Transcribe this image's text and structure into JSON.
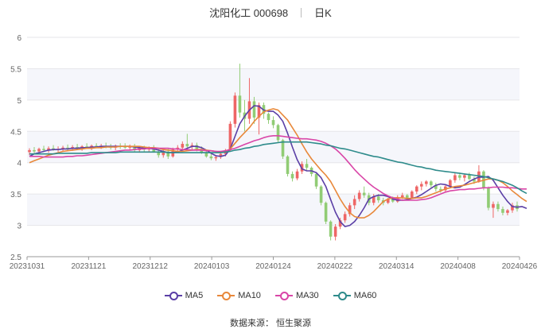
{
  "header": {
    "stock": "沈阳化工 000698",
    "period": "日K"
  },
  "source": "数据来源：  恒生聚源",
  "chart_data": {
    "type": "candlestick",
    "xlabels": [
      "20231031",
      "20231121",
      "20231212",
      "20240103",
      "20240124",
      "20240222",
      "20240314",
      "20240408",
      "20240426"
    ],
    "ylim": [
      2.5,
      6
    ],
    "yticks": [
      "2.5",
      "3",
      "3.5",
      "4",
      "4.5",
      "5",
      "5.5",
      "6"
    ],
    "grid": true,
    "legend_position": "bottom",
    "up_color": "#ee6666",
    "down_color": "#91cc75",
    "candles": [
      {
        "o": 4.17,
        "h": 4.23,
        "l": 4.12,
        "c": 4.2
      },
      {
        "o": 4.2,
        "h": 4.25,
        "l": 4.15,
        "c": 4.18
      },
      {
        "o": 4.18,
        "h": 4.24,
        "l": 4.14,
        "c": 4.22
      },
      {
        "o": 4.22,
        "h": 4.27,
        "l": 4.18,
        "c": 4.2
      },
      {
        "o": 4.2,
        "h": 4.26,
        "l": 4.16,
        "c": 4.23
      },
      {
        "o": 4.23,
        "h": 4.28,
        "l": 4.19,
        "c": 4.21
      },
      {
        "o": 4.21,
        "h": 4.26,
        "l": 4.17,
        "c": 4.22
      },
      {
        "o": 4.22,
        "h": 4.27,
        "l": 4.18,
        "c": 4.24
      },
      {
        "o": 4.24,
        "h": 4.29,
        "l": 4.2,
        "c": 4.22
      },
      {
        "o": 4.22,
        "h": 4.28,
        "l": 4.19,
        "c": 4.25
      },
      {
        "o": 4.25,
        "h": 4.3,
        "l": 4.21,
        "c": 4.23
      },
      {
        "o": 4.23,
        "h": 4.28,
        "l": 4.19,
        "c": 4.26
      },
      {
        "o": 4.26,
        "h": 4.31,
        "l": 4.22,
        "c": 4.24
      },
      {
        "o": 4.24,
        "h": 4.29,
        "l": 4.2,
        "c": 4.27
      },
      {
        "o": 4.27,
        "h": 4.31,
        "l": 4.23,
        "c": 4.25
      },
      {
        "o": 4.25,
        "h": 4.3,
        "l": 4.22,
        "c": 4.27
      },
      {
        "o": 4.27,
        "h": 4.32,
        "l": 4.23,
        "c": 4.26
      },
      {
        "o": 4.26,
        "h": 4.3,
        "l": 4.21,
        "c": 4.24
      },
      {
        "o": 4.24,
        "h": 4.29,
        "l": 4.2,
        "c": 4.27
      },
      {
        "o": 4.27,
        "h": 4.31,
        "l": 4.22,
        "c": 4.26
      },
      {
        "o": 4.26,
        "h": 4.31,
        "l": 4.22,
        "c": 4.24
      },
      {
        "o": 4.24,
        "h": 4.29,
        "l": 4.2,
        "c": 4.26
      },
      {
        "o": 4.26,
        "h": 4.3,
        "l": 4.18,
        "c": 4.2
      },
      {
        "o": 4.2,
        "h": 4.26,
        "l": 4.16,
        "c": 4.23
      },
      {
        "o": 4.23,
        "h": 4.27,
        "l": 4.18,
        "c": 4.21
      },
      {
        "o": 4.21,
        "h": 4.26,
        "l": 4.17,
        "c": 4.24
      },
      {
        "o": 4.24,
        "h": 4.28,
        "l": 4.16,
        "c": 4.18
      },
      {
        "o": 4.18,
        "h": 4.22,
        "l": 4.08,
        "c": 4.12
      },
      {
        "o": 4.12,
        "h": 4.2,
        "l": 4.08,
        "c": 4.18
      },
      {
        "o": 4.18,
        "h": 4.23,
        "l": 4.06,
        "c": 4.1
      },
      {
        "o": 4.1,
        "h": 4.24,
        "l": 4.08,
        "c": 4.21
      },
      {
        "o": 4.21,
        "h": 4.28,
        "l": 4.18,
        "c": 4.24
      },
      {
        "o": 4.24,
        "h": 4.34,
        "l": 4.2,
        "c": 4.3
      },
      {
        "o": 4.3,
        "h": 4.46,
        "l": 4.22,
        "c": 4.26
      },
      {
        "o": 4.26,
        "h": 4.32,
        "l": 4.2,
        "c": 4.28
      },
      {
        "o": 4.28,
        "h": 4.32,
        "l": 4.18,
        "c": 4.22
      },
      {
        "o": 4.22,
        "h": 4.26,
        "l": 4.14,
        "c": 4.16
      },
      {
        "o": 4.16,
        "h": 4.2,
        "l": 4.08,
        "c": 4.1
      },
      {
        "o": 4.1,
        "h": 4.14,
        "l": 4.04,
        "c": 4.07
      },
      {
        "o": 4.07,
        "h": 4.12,
        "l": 4.03,
        "c": 4.09
      },
      {
        "o": 4.09,
        "h": 4.16,
        "l": 4.06,
        "c": 4.14
      },
      {
        "o": 4.14,
        "h": 4.22,
        "l": 4.1,
        "c": 4.2
      },
      {
        "o": 4.2,
        "h": 4.66,
        "l": 4.18,
        "c": 4.62
      },
      {
        "o": 4.62,
        "h": 5.12,
        "l": 4.56,
        "c": 5.07
      },
      {
        "o": 5.07,
        "h": 5.58,
        "l": 4.72,
        "c": 4.8
      },
      {
        "o": 4.8,
        "h": 5.0,
        "l": 4.5,
        "c": 4.7
      },
      {
        "o": 4.7,
        "h": 5.35,
        "l": 4.62,
        "c": 4.98
      },
      {
        "o": 4.98,
        "h": 5.05,
        "l": 4.62,
        "c": 4.72
      },
      {
        "o": 4.72,
        "h": 4.96,
        "l": 4.45,
        "c": 4.92
      },
      {
        "o": 4.92,
        "h": 4.96,
        "l": 4.7,
        "c": 4.78
      },
      {
        "o": 4.78,
        "h": 4.8,
        "l": 4.62,
        "c": 4.68
      },
      {
        "o": 4.68,
        "h": 4.74,
        "l": 4.55,
        "c": 4.6
      },
      {
        "o": 4.6,
        "h": 4.62,
        "l": 4.32,
        "c": 4.36
      },
      {
        "o": 4.36,
        "h": 4.38,
        "l": 4.06,
        "c": 4.1
      },
      {
        "o": 4.1,
        "h": 4.12,
        "l": 3.78,
        "c": 3.82
      },
      {
        "o": 3.82,
        "h": 3.86,
        "l": 3.7,
        "c": 3.75
      },
      {
        "o": 3.75,
        "h": 3.9,
        "l": 3.72,
        "c": 3.86
      },
      {
        "o": 3.86,
        "h": 4.02,
        "l": 3.82,
        "c": 3.98
      },
      {
        "o": 3.98,
        "h": 4.06,
        "l": 3.88,
        "c": 3.92
      },
      {
        "o": 3.92,
        "h": 3.94,
        "l": 3.78,
        "c": 3.82
      },
      {
        "o": 3.82,
        "h": 3.84,
        "l": 3.58,
        "c": 3.62
      },
      {
        "o": 3.62,
        "h": 3.64,
        "l": 3.32,
        "c": 3.36
      },
      {
        "o": 3.36,
        "h": 3.38,
        "l": 3.02,
        "c": 3.06
      },
      {
        "o": 3.06,
        "h": 3.08,
        "l": 2.76,
        "c": 2.82
      },
      {
        "o": 2.82,
        "h": 3.02,
        "l": 2.76,
        "c": 2.98
      },
      {
        "o": 2.98,
        "h": 3.12,
        "l": 2.94,
        "c": 3.08
      },
      {
        "o": 3.08,
        "h": 3.22,
        "l": 3.04,
        "c": 3.18
      },
      {
        "o": 3.18,
        "h": 3.36,
        "l": 3.14,
        "c": 3.32
      },
      {
        "o": 3.32,
        "h": 3.48,
        "l": 3.26,
        "c": 3.42
      },
      {
        "o": 3.42,
        "h": 3.56,
        "l": 3.38,
        "c": 3.52
      },
      {
        "o": 3.52,
        "h": 3.62,
        "l": 3.44,
        "c": 3.48
      },
      {
        "o": 3.48,
        "h": 3.52,
        "l": 3.32,
        "c": 3.36
      },
      {
        "o": 3.36,
        "h": 3.5,
        "l": 3.32,
        "c": 3.46
      },
      {
        "o": 3.46,
        "h": 3.5,
        "l": 3.36,
        "c": 3.4
      },
      {
        "o": 3.4,
        "h": 3.44,
        "l": 3.32,
        "c": 3.36
      },
      {
        "o": 3.36,
        "h": 3.44,
        "l": 3.34,
        "c": 3.42
      },
      {
        "o": 3.42,
        "h": 3.46,
        "l": 3.36,
        "c": 3.38
      },
      {
        "o": 3.38,
        "h": 3.48,
        "l": 3.36,
        "c": 3.45
      },
      {
        "o": 3.45,
        "h": 3.52,
        "l": 3.42,
        "c": 3.48
      },
      {
        "o": 3.48,
        "h": 3.5,
        "l": 3.4,
        "c": 3.44
      },
      {
        "o": 3.44,
        "h": 3.56,
        "l": 3.42,
        "c": 3.54
      },
      {
        "o": 3.54,
        "h": 3.64,
        "l": 3.5,
        "c": 3.62
      },
      {
        "o": 3.62,
        "h": 3.7,
        "l": 3.56,
        "c": 3.66
      },
      {
        "o": 3.66,
        "h": 3.72,
        "l": 3.62,
        "c": 3.7
      },
      {
        "o": 3.7,
        "h": 3.72,
        "l": 3.6,
        "c": 3.64
      },
      {
        "o": 3.64,
        "h": 3.68,
        "l": 3.54,
        "c": 3.58
      },
      {
        "o": 3.58,
        "h": 3.62,
        "l": 3.52,
        "c": 3.56
      },
      {
        "o": 3.56,
        "h": 3.64,
        "l": 3.54,
        "c": 3.62
      },
      {
        "o": 3.62,
        "h": 3.74,
        "l": 3.6,
        "c": 3.72
      },
      {
        "o": 3.72,
        "h": 3.84,
        "l": 3.68,
        "c": 3.8
      },
      {
        "o": 3.8,
        "h": 3.84,
        "l": 3.72,
        "c": 3.76
      },
      {
        "o": 3.76,
        "h": 3.82,
        "l": 3.7,
        "c": 3.8
      },
      {
        "o": 3.8,
        "h": 3.84,
        "l": 3.72,
        "c": 3.74
      },
      {
        "o": 3.74,
        "h": 3.78,
        "l": 3.66,
        "c": 3.7
      },
      {
        "o": 3.7,
        "h": 3.96,
        "l": 3.68,
        "c": 3.86
      },
      {
        "o": 3.86,
        "h": 3.88,
        "l": 3.56,
        "c": 3.6
      },
      {
        "o": 3.6,
        "h": 3.62,
        "l": 3.24,
        "c": 3.28
      },
      {
        "o": 3.28,
        "h": 3.38,
        "l": 3.12,
        "c": 3.34
      },
      {
        "o": 3.34,
        "h": 3.38,
        "l": 3.22,
        "c": 3.26
      },
      {
        "o": 3.26,
        "h": 3.3,
        "l": 3.16,
        "c": 3.2
      },
      {
        "o": 3.2,
        "h": 3.26,
        "l": 3.16,
        "c": 3.24
      },
      {
        "o": 3.24,
        "h": 3.36,
        "l": 3.2,
        "c": 3.32
      },
      {
        "o": 3.32,
        "h": 3.38,
        "l": 3.22,
        "c": 3.26
      }
    ],
    "series": [
      {
        "name": "MA5",
        "color": "#5b3fa6",
        "width": 1.6,
        "values": [
          4.1,
          4.14,
          4.16,
          4.18,
          4.2,
          4.21,
          4.21,
          4.22,
          4.22,
          4.23,
          4.23,
          4.24,
          4.24,
          4.25,
          4.25,
          4.26,
          4.26,
          4.26,
          4.26,
          4.26,
          4.26,
          4.26,
          4.25,
          4.24,
          4.23,
          4.23,
          4.22,
          4.2,
          4.18,
          4.16,
          4.16,
          4.17,
          4.2,
          4.23,
          4.26,
          4.26,
          4.24,
          4.2,
          4.15,
          4.11,
          4.1,
          4.12,
          4.22,
          4.42,
          4.62,
          4.74,
          4.84,
          4.91,
          4.9,
          4.84,
          4.82,
          4.82,
          4.76,
          4.66,
          4.47,
          4.25,
          4.05,
          3.9,
          3.87,
          3.87,
          3.84,
          3.76,
          3.62,
          3.41,
          3.21,
          3.06,
          2.98,
          3.0,
          3.06,
          3.16,
          3.28,
          3.42,
          3.46,
          3.48,
          3.48,
          3.46,
          3.42,
          3.4,
          3.4,
          3.41,
          3.43,
          3.45,
          3.49,
          3.54,
          3.59,
          3.64,
          3.66,
          3.65,
          3.62,
          3.6,
          3.61,
          3.65,
          3.7,
          3.74,
          3.77,
          3.77,
          3.78,
          3.72,
          3.6,
          3.48,
          3.38,
          3.3,
          3.29,
          3.3,
          3.27
        ]
      },
      {
        "name": "MA10",
        "color": "#e8883a",
        "width": 1.6,
        "values": [
          4.0,
          4.03,
          4.06,
          4.09,
          4.12,
          4.14,
          4.16,
          4.18,
          4.19,
          4.2,
          4.21,
          4.22,
          4.23,
          4.23,
          4.24,
          4.24,
          4.25,
          4.25,
          4.25,
          4.26,
          4.26,
          4.26,
          4.26,
          4.26,
          4.25,
          4.24,
          4.24,
          4.23,
          4.21,
          4.2,
          4.19,
          4.18,
          4.18,
          4.19,
          4.2,
          4.21,
          4.21,
          4.2,
          4.19,
          4.18,
          4.17,
          4.18,
          4.22,
          4.31,
          4.4,
          4.48,
          4.56,
          4.66,
          4.74,
          4.81,
          4.84,
          4.86,
          4.84,
          4.76,
          4.68,
          4.56,
          4.44,
          4.3,
          4.17,
          4.06,
          3.97,
          3.88,
          3.8,
          3.7,
          3.56,
          3.42,
          3.3,
          3.2,
          3.14,
          3.12,
          3.12,
          3.16,
          3.22,
          3.3,
          3.38,
          3.42,
          3.44,
          3.44,
          3.44,
          3.43,
          3.43,
          3.44,
          3.44,
          3.46,
          3.49,
          3.52,
          3.55,
          3.58,
          3.6,
          3.62,
          3.63,
          3.64,
          3.66,
          3.68,
          3.7,
          3.72,
          3.74,
          3.74,
          3.72,
          3.68,
          3.62,
          3.55,
          3.49,
          3.43,
          3.38
        ]
      },
      {
        "name": "MA30",
        "color": "#d946a8",
        "width": 1.6,
        "values": [
          4.1,
          4.1,
          4.1,
          4.09,
          4.09,
          4.09,
          4.09,
          4.09,
          4.1,
          4.1,
          4.11,
          4.11,
          4.12,
          4.13,
          4.14,
          4.15,
          4.16,
          4.17,
          4.18,
          4.19,
          4.2,
          4.2,
          4.21,
          4.22,
          4.22,
          4.23,
          4.23,
          4.23,
          4.23,
          4.23,
          4.22,
          4.22,
          4.21,
          4.21,
          4.2,
          4.2,
          4.2,
          4.19,
          4.19,
          4.18,
          4.18,
          4.19,
          4.21,
          4.23,
          4.26,
          4.29,
          4.32,
          4.35,
          4.37,
          4.4,
          4.42,
          4.43,
          4.43,
          4.42,
          4.41,
          4.4,
          4.39,
          4.38,
          4.38,
          4.37,
          4.36,
          4.34,
          4.31,
          4.27,
          4.22,
          4.15,
          4.07,
          3.98,
          3.89,
          3.81,
          3.74,
          3.67,
          3.61,
          3.56,
          3.51,
          3.47,
          3.44,
          3.42,
          3.4,
          3.4,
          3.4,
          3.4,
          3.41,
          3.42,
          3.44,
          3.47,
          3.5,
          3.53,
          3.55,
          3.56,
          3.57,
          3.57,
          3.58,
          3.58,
          3.59,
          3.6,
          3.6,
          3.61,
          3.61,
          3.61,
          3.6,
          3.6,
          3.59,
          3.58,
          3.58
        ]
      },
      {
        "name": "MA60",
        "color": "#2e8b8b",
        "width": 1.6,
        "values": [
          4.14,
          4.14,
          4.14,
          4.14,
          4.14,
          4.14,
          4.15,
          4.15,
          4.15,
          4.15,
          4.15,
          4.15,
          4.15,
          4.16,
          4.16,
          4.16,
          4.16,
          4.16,
          4.16,
          4.17,
          4.17,
          4.17,
          4.17,
          4.17,
          4.17,
          4.17,
          4.17,
          4.17,
          4.17,
          4.16,
          4.16,
          4.16,
          4.16,
          4.16,
          4.16,
          4.16,
          4.16,
          4.16,
          4.16,
          4.16,
          4.16,
          4.17,
          4.18,
          4.2,
          4.21,
          4.23,
          4.24,
          4.26,
          4.27,
          4.29,
          4.3,
          4.31,
          4.32,
          4.33,
          4.33,
          4.33,
          4.33,
          4.33,
          4.33,
          4.32,
          4.31,
          4.3,
          4.28,
          4.27,
          4.25,
          4.23,
          4.22,
          4.2,
          4.18,
          4.16,
          4.14,
          4.12,
          4.1,
          4.09,
          4.07,
          4.05,
          4.03,
          4.01,
          4.0,
          3.98,
          3.96,
          3.94,
          3.93,
          3.91,
          3.9,
          3.88,
          3.87,
          3.86,
          3.85,
          3.84,
          3.83,
          3.82,
          3.81,
          3.8,
          3.79,
          3.78,
          3.76,
          3.74,
          3.72,
          3.7,
          3.67,
          3.64,
          3.6,
          3.55,
          3.51
        ]
      }
    ]
  }
}
